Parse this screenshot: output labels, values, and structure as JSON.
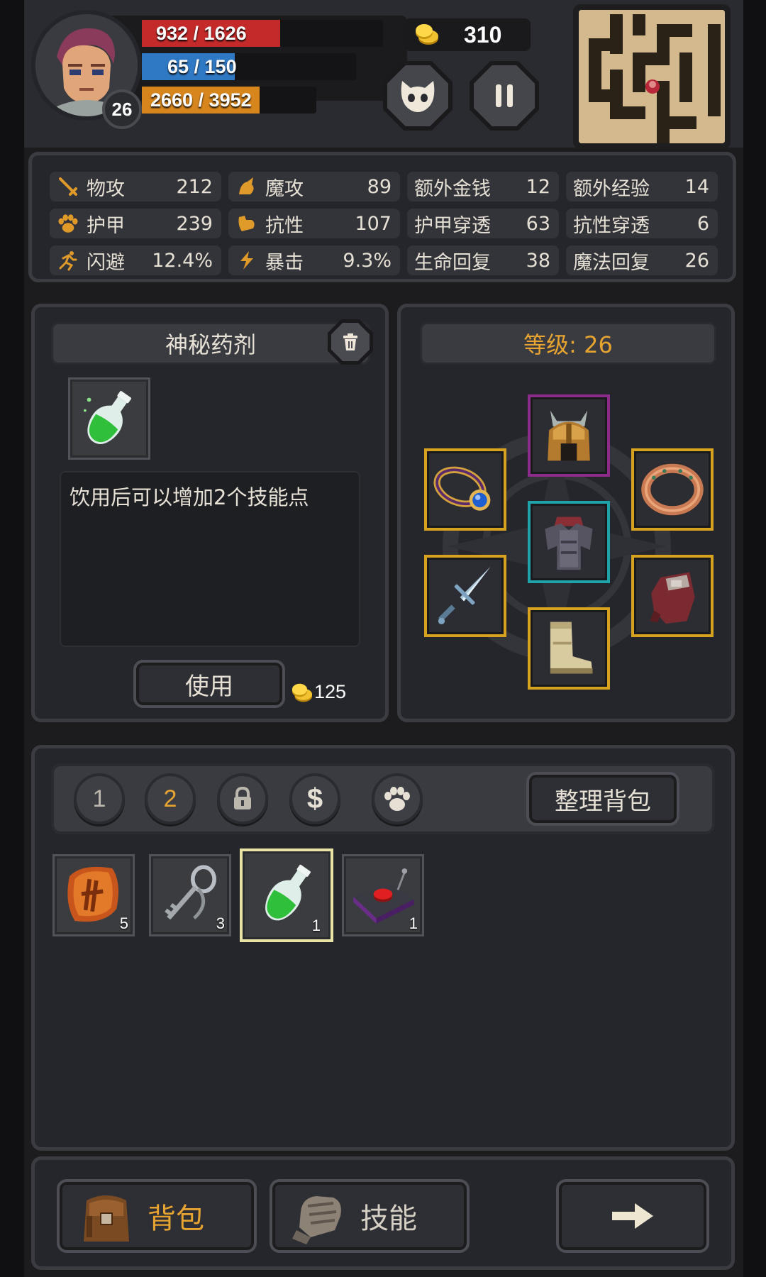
{
  "hud": {
    "hp_text": "932 / 1626",
    "hp_ratio": 0.573,
    "mp_text": "65 / 150",
    "mp_ratio": 0.433,
    "xp_text": "2660 / 3952",
    "xp_ratio": 0.673,
    "level": "26",
    "gold": "310",
    "colors": {
      "hp": "#c42a2a",
      "mp": "#2f78c4",
      "xp": "#d7851d"
    },
    "buttons": {
      "pet_icon": "mask-icon",
      "pause_icon": "pause-icon"
    }
  },
  "stats": [
    {
      "icon": "sword-icon",
      "label": "物攻",
      "value": "212"
    },
    {
      "icon": "magic-icon",
      "label": "魔攻",
      "value": "89"
    },
    {
      "icon": "",
      "label": "额外金钱",
      "value": "12"
    },
    {
      "icon": "",
      "label": "额外经验",
      "value": "14"
    },
    {
      "icon": "paw-icon",
      "label": "护甲",
      "value": "239"
    },
    {
      "icon": "muscle-icon",
      "label": "抗性",
      "value": "107"
    },
    {
      "icon": "",
      "label": "护甲穿透",
      "value": "63"
    },
    {
      "icon": "",
      "label": "抗性穿透",
      "value": "6"
    },
    {
      "icon": "run-icon",
      "label": "闪避",
      "value": "12.4%"
    },
    {
      "icon": "bolt-icon",
      "label": "暴击",
      "value": "9.3%"
    },
    {
      "icon": "",
      "label": "生命回复",
      "value": "38"
    },
    {
      "icon": "",
      "label": "魔法回复",
      "value": "26"
    }
  ],
  "item_detail": {
    "title": "神秘药剂",
    "description": "饮用后可以增加2个技能点",
    "use_label": "使用",
    "price": "125"
  },
  "equipment": {
    "level_label": "等级: 26",
    "slots": [
      "helmet",
      "ring-left",
      "ring-right",
      "armor",
      "sword",
      "gloves",
      "boots"
    ]
  },
  "inventory": {
    "tabs": [
      "1",
      "2"
    ],
    "active_tab": "2",
    "tab_icons": [
      "lock-icon",
      "dollar-icon",
      "paw-icon"
    ],
    "sort_label": "整理背包",
    "items": [
      {
        "name": "rune-stone",
        "count": "5"
      },
      {
        "name": "key",
        "count": "3"
      },
      {
        "name": "green-potion",
        "count": "1"
      },
      {
        "name": "detonator",
        "count": "1"
      }
    ]
  },
  "bottom_nav": {
    "bag_label": "背包",
    "skill_label": "技能"
  }
}
